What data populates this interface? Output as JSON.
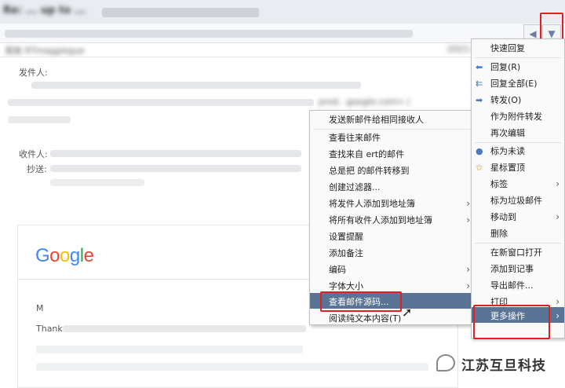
{
  "header": {
    "title": "Re: ... up to ...",
    "date_prefix": "2021-"
  },
  "fields": {
    "sender_label": "发件人:",
    "recipient_label": "收件人:",
    "cc_label": "抄送:",
    "sender_line_visible": "prod.           .google.com> (",
    "from_prefix": "发给 97maggiegue"
  },
  "submenu": {
    "items": [
      {
        "label": "发送新邮件给相同接收人",
        "has_arrow": false
      },
      {
        "label": "查看往来邮件",
        "has_arrow": false
      },
      {
        "label": "查找来自                 ert的邮件",
        "has_arrow": false
      },
      {
        "label": "总是把                 的邮件转移到",
        "has_arrow": false
      },
      {
        "label": "创建过滤器...",
        "has_arrow": false
      },
      {
        "label": "将发件人添加到地址簿",
        "has_arrow": true
      },
      {
        "label": "将所有收件人添加到地址簿",
        "has_arrow": true
      },
      {
        "label": "设置提醒",
        "has_arrow": false
      },
      {
        "label": "添加备注",
        "has_arrow": false
      },
      {
        "label": "编码",
        "has_arrow": true
      },
      {
        "label": "字体大小",
        "has_arrow": true
      },
      {
        "label": "查看邮件源码...",
        "has_arrow": false
      },
      {
        "label": "阅读纯文本内容(T)",
        "has_arrow": false
      }
    ],
    "highlighted": "查看邮件源码..."
  },
  "main_menu": {
    "items": [
      {
        "label": "快速回复",
        "icon": ""
      },
      {
        "label": "回复(R)",
        "icon": "reply-icon"
      },
      {
        "label": "回复全部(E)",
        "icon": "reply-all-icon"
      },
      {
        "label": "转发(O)",
        "icon": "forward-icon"
      },
      {
        "label": "作为附件转发",
        "icon": ""
      },
      {
        "label": "再次编辑",
        "icon": ""
      },
      {
        "label": "标为未读",
        "icon": "unread-dot-icon"
      },
      {
        "label": "星标置顶",
        "icon": "star-icon"
      },
      {
        "label": "标签",
        "icon": "",
        "has_arrow": true
      },
      {
        "label": "标为垃圾邮件",
        "icon": ""
      },
      {
        "label": "移动到",
        "icon": "",
        "has_arrow": true
      },
      {
        "label": "删除",
        "icon": ""
      },
      {
        "label": "在新窗口打开",
        "icon": ""
      },
      {
        "label": "添加到记事",
        "icon": ""
      },
      {
        "label": "导出邮件...",
        "icon": ""
      },
      {
        "label": "打印",
        "icon": "",
        "has_arrow": true
      },
      {
        "label": "更多操作",
        "icon": "",
        "has_arrow": true
      }
    ],
    "highlighted": "更多操作"
  },
  "body": {
    "logo": "Google",
    "line1": "M",
    "line2": "Thank"
  },
  "watermark": {
    "text": "江苏互旦科技"
  },
  "colors": {
    "highlight": "#5a7495",
    "annotation": "#e02020",
    "icon_blue": "#4a78c2"
  }
}
